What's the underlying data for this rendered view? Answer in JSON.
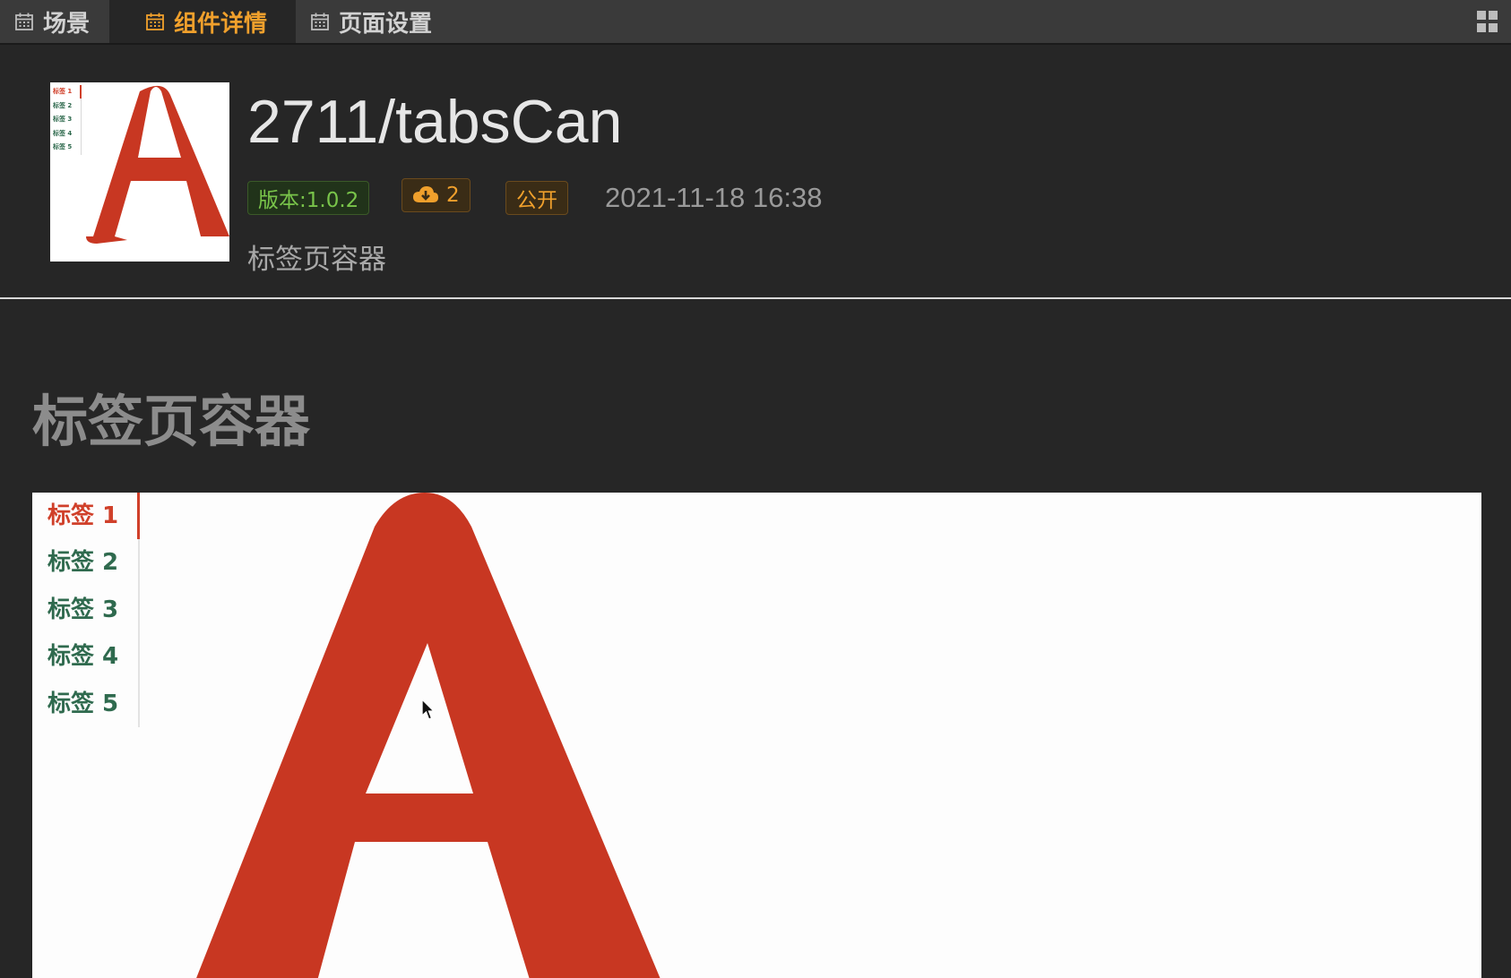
{
  "tabs": [
    {
      "label": "场景"
    },
    {
      "label": "组件详情"
    },
    {
      "label": "页面设置"
    }
  ],
  "component": {
    "title": "2711/tabsCan",
    "version": "版本:1.0.2",
    "downloads": "2",
    "visibility": "公开",
    "date": "2021-11-18 16:38",
    "description": "标签页容器"
  },
  "section": {
    "title": "标签页容器"
  },
  "preview": {
    "tabs": [
      {
        "label": "标签 1"
      },
      {
        "label": "标签 2"
      },
      {
        "label": "标签 3"
      },
      {
        "label": "标签 4"
      },
      {
        "label": "标签 5"
      }
    ],
    "big_letter": "A",
    "active_index": 0
  },
  "thumbnail": {
    "tabs": [
      "标签 1",
      "标签 2",
      "标签 3",
      "标签 4",
      "标签 5"
    ]
  },
  "colors": {
    "accent": "#f0a02c",
    "version_green": "#79c44a",
    "tab_red": "#d0402a",
    "tab_green": "#2f6a4e",
    "letter_red": "#c83722"
  },
  "icons": {
    "tab": "calendar-icon",
    "downloads": "cloud-download-icon",
    "layout": "grid-icon"
  }
}
